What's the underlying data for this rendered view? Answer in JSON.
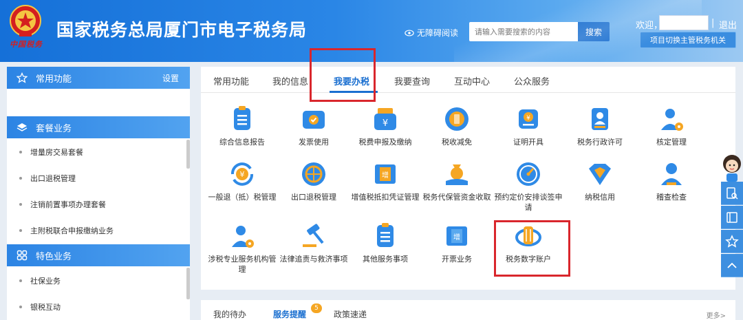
{
  "header": {
    "brand_script": "中国税务",
    "title": "国家税务总局厦门市电子税务局",
    "accessibility": "无障碍阅读",
    "search_placeholder": "请输入需要搜索的内容",
    "search_button": "搜索",
    "welcome": "欢迎，",
    "separator": "|",
    "logout": "退出",
    "switch_button": "项目切换主管税务机关"
  },
  "sidebar": {
    "common": {
      "title": "常用功能",
      "settings": "设置"
    },
    "package": {
      "title": "套餐业务",
      "items": [
        "增量房交易套餐",
        "出口退税管理",
        "注销前置事项办理套餐",
        "主附税联合申报缴纳业务"
      ]
    },
    "special": {
      "title": "特色业务",
      "items": [
        "社保业务",
        "银税互动"
      ]
    }
  },
  "main": {
    "tabs": [
      "常用功能",
      "我的信息",
      "我要办税",
      "我要查询",
      "互动中心",
      "公众服务"
    ],
    "active_tab": "我要办税",
    "functions": [
      {
        "label": "综合信息报告",
        "icon": "report-icon"
      },
      {
        "label": "发票使用",
        "icon": "invoice-icon"
      },
      {
        "label": "税费申报及缴纳",
        "icon": "tax-declaration-icon"
      },
      {
        "label": "税收减免",
        "icon": "tax-reduction-icon"
      },
      {
        "label": "证明开具",
        "icon": "certificate-icon"
      },
      {
        "label": "税务行政许可",
        "icon": "license-icon"
      },
      {
        "label": "核定管理",
        "icon": "verification-icon"
      },
      {
        "label": "一般退（抵）税管理",
        "icon": "tax-refund-icon"
      },
      {
        "label": "出口退税管理",
        "icon": "export-refund-icon"
      },
      {
        "label": "增值税抵扣凭证管理",
        "icon": "vat-voucher-icon"
      },
      {
        "label": "税务代保管资金收取",
        "icon": "fund-custody-icon"
      },
      {
        "label": "预约定价安排谈签申请",
        "icon": "pricing-arrangement-icon"
      },
      {
        "label": "纳税信用",
        "icon": "tax-credit-icon"
      },
      {
        "label": "稽查检查",
        "icon": "inspection-icon"
      },
      {
        "label": "涉税专业服务机构管理",
        "icon": "agency-icon"
      },
      {
        "label": "法律追责与救济事项",
        "icon": "legal-hammer-icon"
      },
      {
        "label": "其他服务事项",
        "icon": "other-services-icon"
      },
      {
        "label": "开票业务",
        "icon": "billing-icon"
      },
      {
        "label": "税务数字账户",
        "icon": "digital-account-icon"
      }
    ]
  },
  "bottom": {
    "tabs": [
      "我的待办",
      "服务提醒",
      "政策速递"
    ],
    "active_tab": "服务提醒",
    "badge": "5",
    "more": "更多>"
  },
  "colors": {
    "primary": "#1a6fd0",
    "icon_blue": "#2f8ae6",
    "icon_orange": "#f5a623",
    "highlight_red": "#d9262c"
  }
}
